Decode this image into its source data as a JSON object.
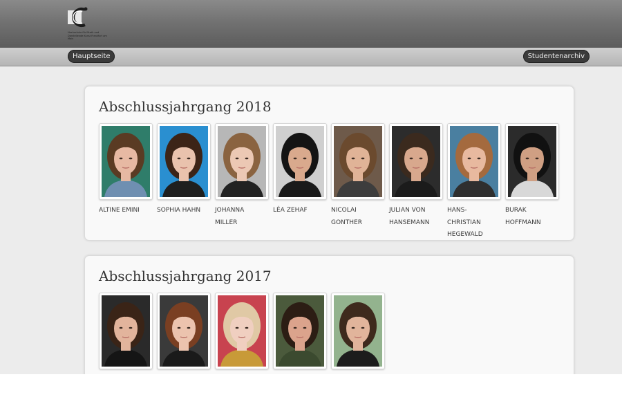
{
  "nav": {
    "home_label": "Hauptseite",
    "archive_label": "Studentenarchiv"
  },
  "logo": {
    "text": "Hochschule für Musik und Darstellende Kunst Frankfurt am Main"
  },
  "sections": [
    {
      "title": "Abschlussjahrgang 2018",
      "students": [
        {
          "name_lines": [
            "Altine Emini"
          ],
          "bg": "#2f7d6a",
          "hair": "#5a3b23",
          "skin": "#e7b9a3",
          "shirt": "#6f8fb1"
        },
        {
          "name_lines": [
            "Sophia Hahn"
          ],
          "bg": "#2a8fd0",
          "hair": "#3c2417",
          "skin": "#e9c2ad",
          "shirt": "#1f1f1f"
        },
        {
          "name_lines": [
            "Johanna",
            "Miller"
          ],
          "bg": "#b7b7b7",
          "hair": "#8a6340",
          "skin": "#ecc8b4",
          "shirt": "#222222"
        },
        {
          "name_lines": [
            "Léa Zehaf"
          ],
          "bg": "#cfcfcf",
          "hair": "#141414",
          "skin": "#d9a98d",
          "shirt": "#1a1a1a"
        },
        {
          "name_lines": [
            "Nicolai",
            "Gonther"
          ],
          "bg": "#6e5a4a",
          "hair": "#6b4a2e",
          "skin": "#e0b397",
          "shirt": "#3d3d3d"
        },
        {
          "name_lines": [
            "Julian von",
            "Hansemann"
          ],
          "bg": "#2c2c2c",
          "hair": "#3b2a1e",
          "skin": "#d8a88d",
          "shirt": "#1b1b1b"
        },
        {
          "name_lines": [
            "Hans-",
            "Christian",
            "Hegewald"
          ],
          "bg": "#4a7fa0",
          "hair": "#a46a3e",
          "skin": "#e8b99f",
          "shirt": "#2f2f2f"
        },
        {
          "name_lines": [
            "Burak",
            "Hoffmann"
          ],
          "bg": "#2b2b2b",
          "hair": "#111111",
          "skin": "#cf9f83",
          "shirt": "#d8d8d8"
        }
      ]
    },
    {
      "title": "Abschlussjahrgang 2017",
      "students": [
        {
          "name_lines": [],
          "bg": "#2a2a2a",
          "hair": "#3a2417",
          "skin": "#e2b49c",
          "shirt": "#151515"
        },
        {
          "name_lines": [],
          "bg": "#3a3a3a",
          "hair": "#7a3f22",
          "skin": "#ecc3ae",
          "shirt": "#1a1a1a"
        },
        {
          "name_lines": [],
          "bg": "#c8434f",
          "hair": "#e0c9a5",
          "skin": "#f0cfc0",
          "shirt": "#c89a38"
        },
        {
          "name_lines": [],
          "bg": "#4b5a3c",
          "hair": "#2c1d14",
          "skin": "#dba38c",
          "shirt": "#3b4a2f"
        },
        {
          "name_lines": [],
          "bg": "#93b38e",
          "hair": "#3e2a1d",
          "skin": "#e1b49b",
          "shirt": "#1c1c1c"
        }
      ]
    }
  ]
}
